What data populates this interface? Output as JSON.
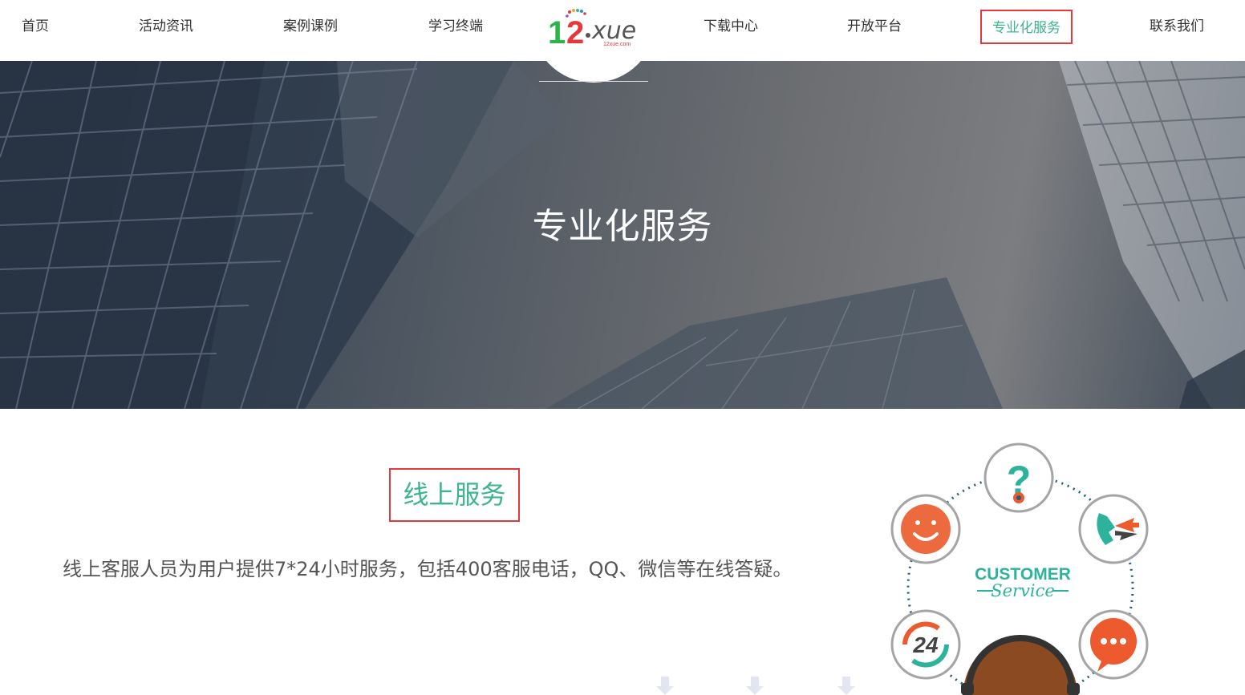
{
  "nav": {
    "items": [
      {
        "label": "首页"
      },
      {
        "label": "活动资讯"
      },
      {
        "label": "案例课例"
      },
      {
        "label": "学习终端"
      },
      {
        "label": "下载中心"
      },
      {
        "label": "开放平台"
      },
      {
        "label": "专业化服务",
        "active": true
      },
      {
        "label": "联系我们"
      }
    ],
    "logo": {
      "main": "12xue",
      "sub": "12xue.com"
    }
  },
  "hero": {
    "title": "专业化服务"
  },
  "section": {
    "title": "线上服务",
    "desc": "线上客服人员为用户提供7*24小时服务，包括400客服电话，QQ、微信等在线答疑。"
  },
  "cs_graphic": {
    "line1": "CUSTOMER",
    "line2": "Service",
    "badge": "24"
  },
  "colors": {
    "accent": "#3cb48e",
    "highlight_border": "#e5383b",
    "icon_orange": "#ec5a2e",
    "icon_teal": "#2db39b"
  }
}
